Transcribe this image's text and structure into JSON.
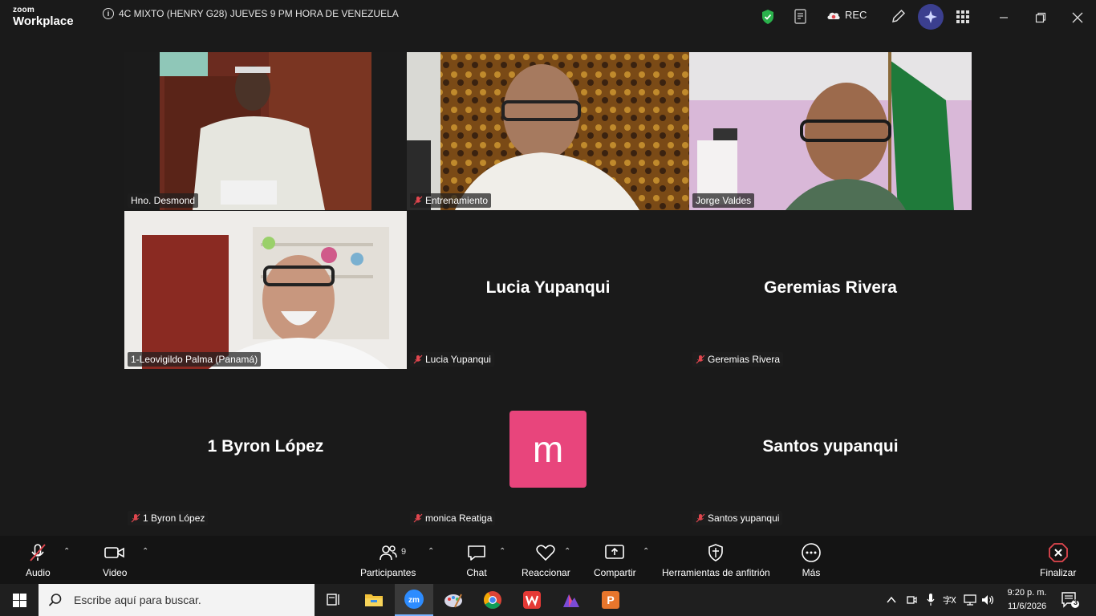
{
  "app": {
    "logo_small": "zoom",
    "logo_big": "Workplace",
    "meeting_title": "4C MIXTO (HENRY G28) JUEVES 9 PM HORA DE VENEZUELA",
    "rec_label": "REC"
  },
  "colors": {
    "active_speaker": "#3ccf6e",
    "avatar_bg": "#e8457c",
    "muted": "#e0464e"
  },
  "tiles": [
    {
      "name": "Hno. Desmond",
      "muted": false,
      "video": true
    },
    {
      "name": "Entrenamiento",
      "muted": true,
      "video": true
    },
    {
      "name": "Jorge Valdes",
      "muted": false,
      "video": true,
      "active": true
    },
    {
      "name": "1-Leovigildo Palma (Panamá)",
      "muted": false,
      "video": true
    },
    {
      "name": "Lucia Yupanqui",
      "display": "Lucia Yupanqui",
      "muted": true,
      "video": false
    },
    {
      "name": "Geremias Rivera",
      "display": "Geremias Rivera",
      "muted": true,
      "video": false
    },
    {
      "name": "1 Byron López",
      "display": "1 Byron López",
      "muted": true,
      "video": false
    },
    {
      "name": "monica Reatiga",
      "avatar_letter": "m",
      "muted": true,
      "video": false
    },
    {
      "name": "Santos yupanqui",
      "display": "Santos yupanqui",
      "muted": true,
      "video": false
    }
  ],
  "toolbar": {
    "audio": "Audio",
    "video": "Video",
    "participants": "Participantes",
    "participants_count": "9",
    "chat": "Chat",
    "react": "Reaccionar",
    "share": "Compartir",
    "host_tools": "Herramientas de anfitrión",
    "more": "Más",
    "end": "Finalizar"
  },
  "taskbar": {
    "search_placeholder": "Escribe aquí para buscar.",
    "time": "9:20 p. m.",
    "date": "11/6/2026",
    "notifications": "3",
    "apps": [
      "task-view",
      "file-explorer",
      "zoom",
      "paint",
      "chrome",
      "wps-office",
      "affinity",
      "powerpoint"
    ]
  }
}
